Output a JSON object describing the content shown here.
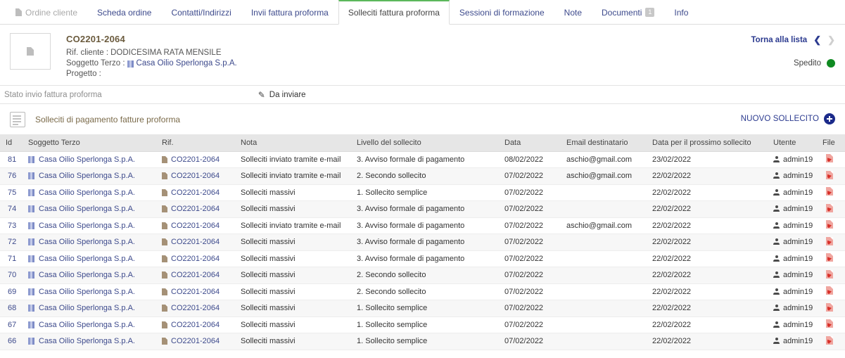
{
  "tabs": [
    {
      "label": "Ordine cliente",
      "state": "disabled",
      "icon": "document-icon"
    },
    {
      "label": "Scheda ordine",
      "state": "normal"
    },
    {
      "label": "Contatti/Indirizzi",
      "state": "normal"
    },
    {
      "label": "Invii fattura proforma",
      "state": "normal"
    },
    {
      "label": "Solleciti fattura proforma",
      "state": "active"
    },
    {
      "label": "Sessioni di formazione",
      "state": "normal"
    },
    {
      "label": "Note",
      "state": "normal"
    },
    {
      "label": "Documenti",
      "state": "normal",
      "badge": "1"
    },
    {
      "label": "Info",
      "state": "normal"
    }
  ],
  "record": {
    "thumb_icon": "document-icon",
    "title": "CO2201-2064",
    "rif_cliente_label": "Rif. cliente :",
    "rif_cliente_value": "DODICESIMA RATA MENSILE",
    "soggetto_label": "Soggetto Terzo :",
    "soggetto_value": "Casa Oilio Sperlonga S.p.A.",
    "progetto_label": "Progetto :",
    "progetto_value": "",
    "back_to_list": "Torna alla lista",
    "prev_icon": "chevron-left-icon",
    "next_icon": "chevron-right-icon",
    "status_label": "Spedito",
    "status_color": "#0f8a21"
  },
  "state_bar": {
    "label": "Stato invio fattura proforma",
    "edit_icon": "pencil-icon",
    "value": "Da inviare"
  },
  "section": {
    "icon": "document-list-icon",
    "title": "Solleciti di pagamento fatture proforma",
    "new_button_label": "NUOVO SOLLECITO",
    "new_button_icon": "plus-circle-icon",
    "accent_color": "#1b2a8a"
  },
  "table": {
    "columns": [
      "Id",
      "Soggetto Terzo",
      "Rif.",
      "Nota",
      "Livello del sollecito",
      "Data",
      "Email destinatario",
      "Data per il prossimo sollecito",
      "Utente",
      "File"
    ],
    "rows": [
      {
        "id": "81",
        "soggetto": "Casa Oilio Sperlonga S.p.A.",
        "rif": "CO2201-2064",
        "nota": "Solleciti inviato tramite e-mail",
        "livello": "3. Avviso formale di pagamento",
        "data": "08/02/2022",
        "email": "aschio@gmail.com",
        "next": "23/02/2022",
        "utente": "admin19",
        "file": "pdf-icon"
      },
      {
        "id": "76",
        "soggetto": "Casa Oilio Sperlonga S.p.A.",
        "rif": "CO2201-2064",
        "nota": "Solleciti inviato tramite e-mail",
        "livello": "2. Secondo sollecito",
        "data": "07/02/2022",
        "email": "aschio@gmail.com",
        "next": "22/02/2022",
        "utente": "admin19",
        "file": "pdf-icon"
      },
      {
        "id": "75",
        "soggetto": "Casa Oilio Sperlonga S.p.A.",
        "rif": "CO2201-2064",
        "nota": "Solleciti massivi",
        "livello": "1. Sollecito semplice",
        "data": "07/02/2022",
        "email": "",
        "next": "22/02/2022",
        "utente": "admin19",
        "file": "pdf-icon"
      },
      {
        "id": "74",
        "soggetto": "Casa Oilio Sperlonga S.p.A.",
        "rif": "CO2201-2064",
        "nota": "Solleciti massivi",
        "livello": "3. Avviso formale di pagamento",
        "data": "07/02/2022",
        "email": "",
        "next": "22/02/2022",
        "utente": "admin19",
        "file": "pdf-icon"
      },
      {
        "id": "73",
        "soggetto": "Casa Oilio Sperlonga S.p.A.",
        "rif": "CO2201-2064",
        "nota": "Solleciti inviato tramite e-mail",
        "livello": "3. Avviso formale di pagamento",
        "data": "07/02/2022",
        "email": "aschio@gmail.com",
        "next": "22/02/2022",
        "utente": "admin19",
        "file": "pdf-icon"
      },
      {
        "id": "72",
        "soggetto": "Casa Oilio Sperlonga S.p.A.",
        "rif": "CO2201-2064",
        "nota": "Solleciti massivi",
        "livello": "3. Avviso formale di pagamento",
        "data": "07/02/2022",
        "email": "",
        "next": "22/02/2022",
        "utente": "admin19",
        "file": "pdf-icon"
      },
      {
        "id": "71",
        "soggetto": "Casa Oilio Sperlonga S.p.A.",
        "rif": "CO2201-2064",
        "nota": "Solleciti massivi",
        "livello": "3. Avviso formale di pagamento",
        "data": "07/02/2022",
        "email": "",
        "next": "22/02/2022",
        "utente": "admin19",
        "file": "pdf-icon"
      },
      {
        "id": "70",
        "soggetto": "Casa Oilio Sperlonga S.p.A.",
        "rif": "CO2201-2064",
        "nota": "Solleciti massivi",
        "livello": "2. Secondo sollecito",
        "data": "07/02/2022",
        "email": "",
        "next": "22/02/2022",
        "utente": "admin19",
        "file": "pdf-icon"
      },
      {
        "id": "69",
        "soggetto": "Casa Oilio Sperlonga S.p.A.",
        "rif": "CO2201-2064",
        "nota": "Solleciti massivi",
        "livello": "2. Secondo sollecito",
        "data": "07/02/2022",
        "email": "",
        "next": "22/02/2022",
        "utente": "admin19",
        "file": "pdf-icon"
      },
      {
        "id": "68",
        "soggetto": "Casa Oilio Sperlonga S.p.A.",
        "rif": "CO2201-2064",
        "nota": "Solleciti massivi",
        "livello": "1. Sollecito semplice",
        "data": "07/02/2022",
        "email": "",
        "next": "22/02/2022",
        "utente": "admin19",
        "file": "pdf-icon"
      },
      {
        "id": "67",
        "soggetto": "Casa Oilio Sperlonga S.p.A.",
        "rif": "CO2201-2064",
        "nota": "Solleciti massivi",
        "livello": "1. Sollecito semplice",
        "data": "07/02/2022",
        "email": "",
        "next": "22/02/2022",
        "utente": "admin19",
        "file": "pdf-icon"
      },
      {
        "id": "66",
        "soggetto": "Casa Oilio Sperlonga S.p.A.",
        "rif": "CO2201-2064",
        "nota": "Solleciti massivi",
        "livello": "1. Sollecito semplice",
        "data": "07/02/2022",
        "email": "",
        "next": "22/02/2022",
        "utente": "admin19",
        "file": "pdf-icon"
      }
    ]
  }
}
